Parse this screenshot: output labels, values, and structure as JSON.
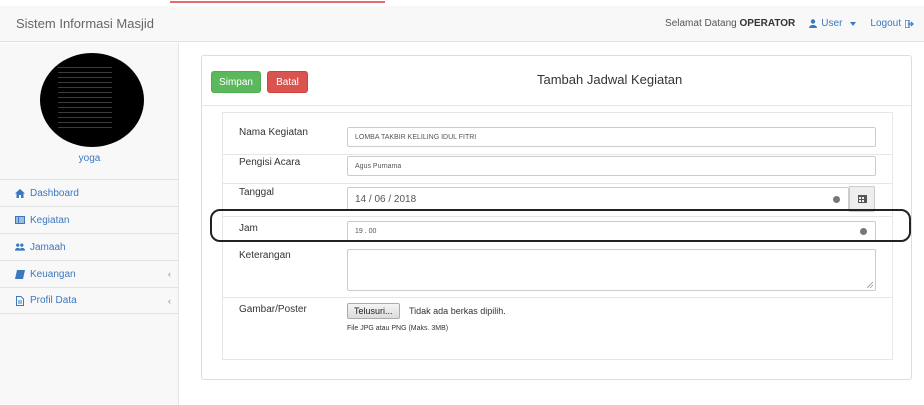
{
  "navbar": {
    "brand": "Sistem Informasi Masjid",
    "welcome_prefix": "Selamat Datang",
    "welcome_user": "OPERATOR",
    "user_menu": "User",
    "logout": "Logout"
  },
  "sidebar": {
    "username": "yoga",
    "items": [
      {
        "label": "Dashboard",
        "icon": "home-icon"
      },
      {
        "label": "Kegiatan",
        "icon": "list-icon"
      },
      {
        "label": "Jamaah",
        "icon": "users-icon"
      },
      {
        "label": "Keuangan",
        "icon": "book-icon"
      },
      {
        "label": "Profil Data",
        "icon": "file-icon"
      }
    ],
    "arrow": "‹"
  },
  "panel": {
    "save_label": "Simpan",
    "cancel_label": "Batal",
    "title": "Tambah Jadwal Kegiatan"
  },
  "form": {
    "nama_label": "Nama Kegiatan",
    "nama_value": "LOMBA TAKBIR KELILING IDUL FITRI",
    "pengisi_label": "Pengisi Acara",
    "pengisi_value": "Agus Purnama",
    "tanggal_label": "Tanggal",
    "tanggal_value": "14 / 06 / 2018",
    "jam_label": "Jam",
    "jam_value": "19 . 00",
    "keterangan_label": "Keterangan",
    "gambar_label": "Gambar/Poster",
    "browse_label": "Telusuri...",
    "file_status": "Tidak ada berkas dipilih.",
    "file_help": "File JPG atau PNG (Maks. 3MB)"
  },
  "colors": {
    "accent": "#3c78c0",
    "save": "#5cb85c",
    "cancel": "#d9534f"
  }
}
